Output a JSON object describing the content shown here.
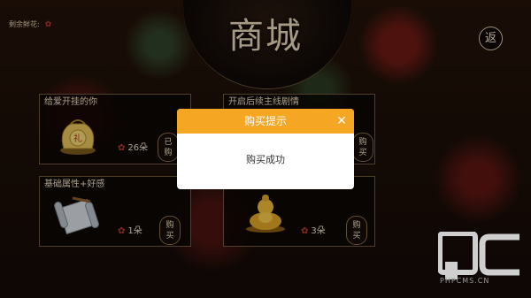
{
  "header": {
    "remaining_label": "剩余鲜花:",
    "rose_icon": "rose-icon",
    "title": "商城",
    "back_label": "返"
  },
  "shop": {
    "items": [
      {
        "title": "给爱开挂的你",
        "icon": "gift-bag-icon",
        "price": "26朵",
        "button_label": [
          "已",
          "购"
        ]
      },
      {
        "title": "开启后续主线剧情",
        "icon": "scroll-icon",
        "price": "",
        "button_label": [
          "购",
          "买"
        ]
      },
      {
        "title": "基础属性+好感",
        "icon": "scroll-icon",
        "price": "1朵",
        "button_label": [
          "购",
          "买"
        ]
      },
      {
        "title": "",
        "icon": "golden-buddha-icon",
        "price": "3朵",
        "button_label": [
          "购",
          "买"
        ]
      }
    ]
  },
  "dialog": {
    "title": "购买提示",
    "message": "购买成功",
    "close_icon": "close-icon",
    "header_color": "#f5a623"
  },
  "watermark": {
    "logo": "pc-logo",
    "text": "PHPCMS.CN"
  }
}
